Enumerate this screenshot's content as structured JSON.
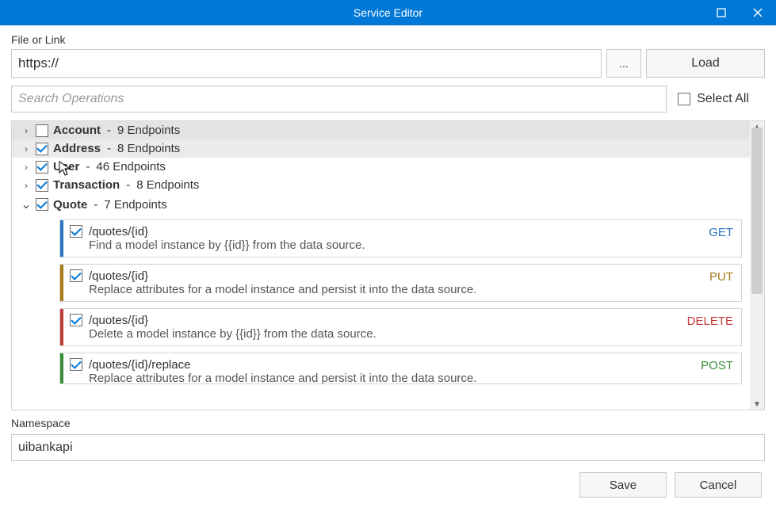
{
  "window": {
    "title": "Service Editor"
  },
  "labels": {
    "file_or_link": "File or Link",
    "url_value": "https://",
    "browse_label": "...",
    "load_label": "Load",
    "search_placeholder": "Search Operations",
    "select_all": "Select All",
    "namespace_label": "Namespace",
    "namespace_value": "uibankapi",
    "save_label": "Save",
    "cancel_label": "Cancel"
  },
  "select_all_checked": false,
  "tree": [
    {
      "name": "Account",
      "count": 9,
      "checked": false,
      "expanded": false,
      "highlight": true
    },
    {
      "name": "Address",
      "count": 8,
      "checked": true,
      "expanded": false,
      "highlight2": true
    },
    {
      "name": "User",
      "count": 46,
      "checked": true,
      "expanded": false
    },
    {
      "name": "Transaction",
      "count": 8,
      "checked": true,
      "expanded": false
    },
    {
      "name": "Quote",
      "count": 7,
      "checked": true,
      "expanded": true
    }
  ],
  "endpoints_suffix": "Endpoints",
  "operations": [
    {
      "checked": true,
      "path": "/quotes/{id}",
      "desc": "Find a model instance by {{id}} from the data source.",
      "method": "GET",
      "method_class": "get"
    },
    {
      "checked": true,
      "path": "/quotes/{id}",
      "desc": "Replace attributes for a model instance and persist it into the data source.",
      "method": "PUT",
      "method_class": "put"
    },
    {
      "checked": true,
      "path": "/quotes/{id}",
      "desc": "Delete a model instance by {{id}} from the data source.",
      "method": "DELETE",
      "method_class": "delete"
    },
    {
      "checked": true,
      "path": "/quotes/{id}/replace",
      "desc": "Replace attributes for a model instance and persist it into the data source.",
      "method": "POST",
      "method_class": "post",
      "cut": true
    }
  ]
}
